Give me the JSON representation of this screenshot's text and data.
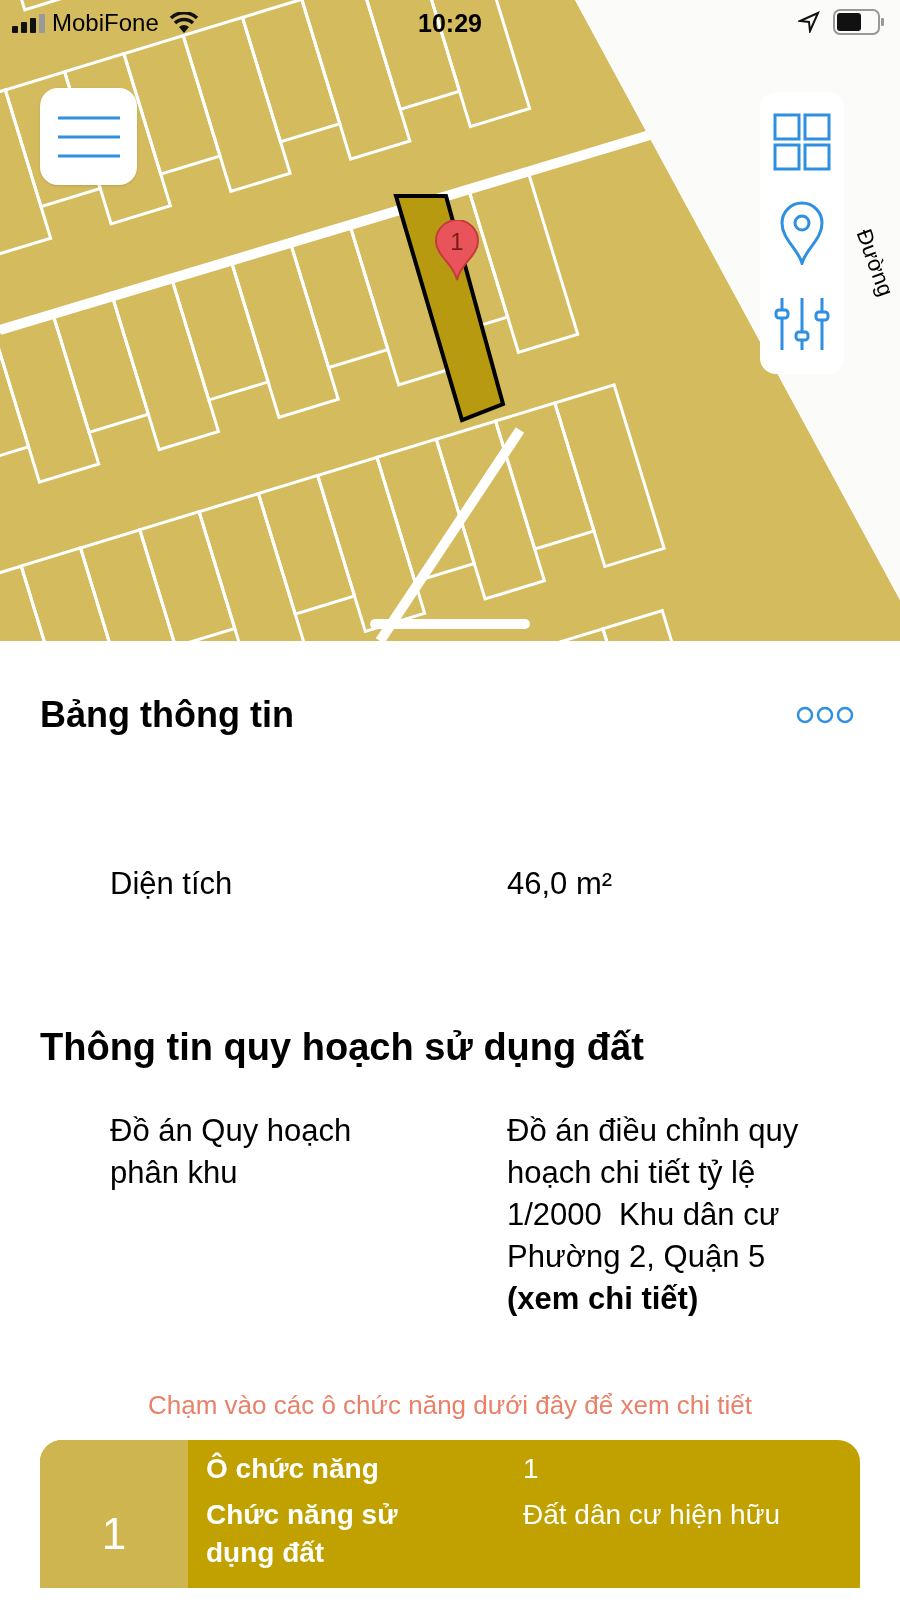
{
  "status_bar": {
    "carrier": "MobiFone",
    "time": "10:29"
  },
  "map": {
    "road_label": "Đường",
    "marker": {
      "label": "1"
    }
  },
  "sheet": {
    "title": "Bảng thông tin"
  },
  "parcel_info": [
    {
      "label": "Diện tích",
      "value": "46,0 m²"
    }
  ],
  "planning": {
    "heading": "Thông tin quy hoạch sử dụng đất",
    "rows": [
      {
        "label": "Đồ án Quy hoạch phân khu",
        "value": "Đồ án điều chỉnh quy hoạch chi tiết tỷ lệ 1/2000  Khu dân cư Phường 2, Quận 5",
        "link": "(xem chi tiết)"
      }
    ]
  },
  "hint": "Chạm vào các ô chức năng dưới đây để xem chi tiết",
  "zones": [
    {
      "number": "1",
      "rows": [
        {
          "label": "Ô chức năng",
          "value": "1"
        },
        {
          "label": "Chức năng sử dụng đất",
          "value": "Đất dân cư hiện hữu"
        }
      ]
    }
  ]
}
